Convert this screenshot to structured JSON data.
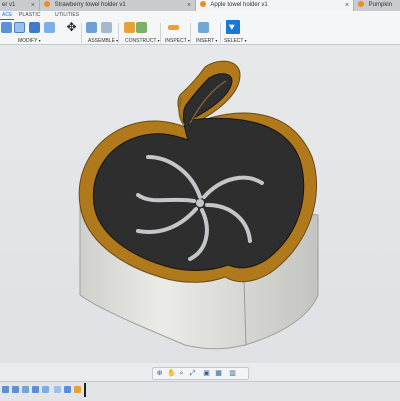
{
  "tabs": [
    {
      "label": "er v1"
    },
    {
      "label": "Strawberry towel holder v1"
    },
    {
      "label": "Apple towel holder v1"
    },
    {
      "label": "Pumpkin"
    }
  ],
  "toolbar": {
    "workspace_tabs": [
      "ACE",
      "PLASTIC",
      "UTILITIES"
    ],
    "groups": [
      "MODIFY",
      "ASSEMBLE",
      "CONSTRUCT",
      "INSPECT",
      "INSERT",
      "SELECT"
    ]
  },
  "model": {
    "name": "Apple towel holder",
    "colors": {
      "body": "#dcdcd8",
      "rim": "#b07a1c",
      "top": "#2e2e2f",
      "slots": "#c4c6c9"
    }
  },
  "icons": {
    "toolbar": [
      "fillet-icon",
      "press-pull-icon",
      "shell-icon",
      "move-icon",
      "new-component-icon",
      "joint-icon",
      "plane-icon",
      "measure-icon",
      "insert-image-icon",
      "select-icon"
    ],
    "nav": [
      "orbit-icon",
      "pan-icon",
      "zoom-icon",
      "fit-icon",
      "display-icon",
      "grid-icon",
      "viewports-icon"
    ],
    "timeline": [
      "first-icon",
      "prev-icon",
      "play-icon",
      "next-icon",
      "last-icon",
      "feature-icon"
    ]
  }
}
